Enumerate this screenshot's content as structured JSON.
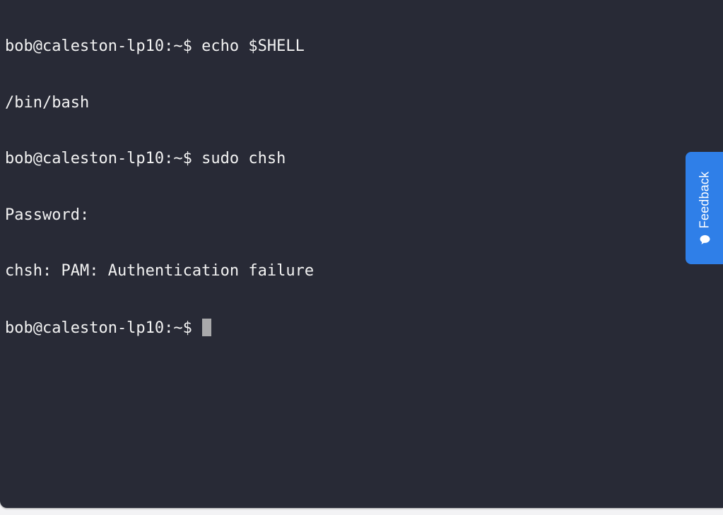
{
  "terminal": {
    "lines": [
      {
        "prompt": "bob@caleston-lp10:~$",
        "command": "echo $SHELL"
      },
      {
        "output": "/bin/bash"
      },
      {
        "prompt": "bob@caleston-lp10:~$",
        "command": "sudo chsh"
      },
      {
        "output": "Password:"
      },
      {
        "output": "chsh: PAM: Authentication failure"
      },
      {
        "prompt": "bob@caleston-lp10:~$",
        "command": ""
      }
    ]
  },
  "feedback": {
    "label": "Feedback",
    "icon": "speech-bubble-icon"
  },
  "colors": {
    "terminal_bg": "#282a36",
    "terminal_text": "#f2f2f2",
    "cursor": "#a9a9ab",
    "feedback_bg": "#2f7fe8"
  }
}
